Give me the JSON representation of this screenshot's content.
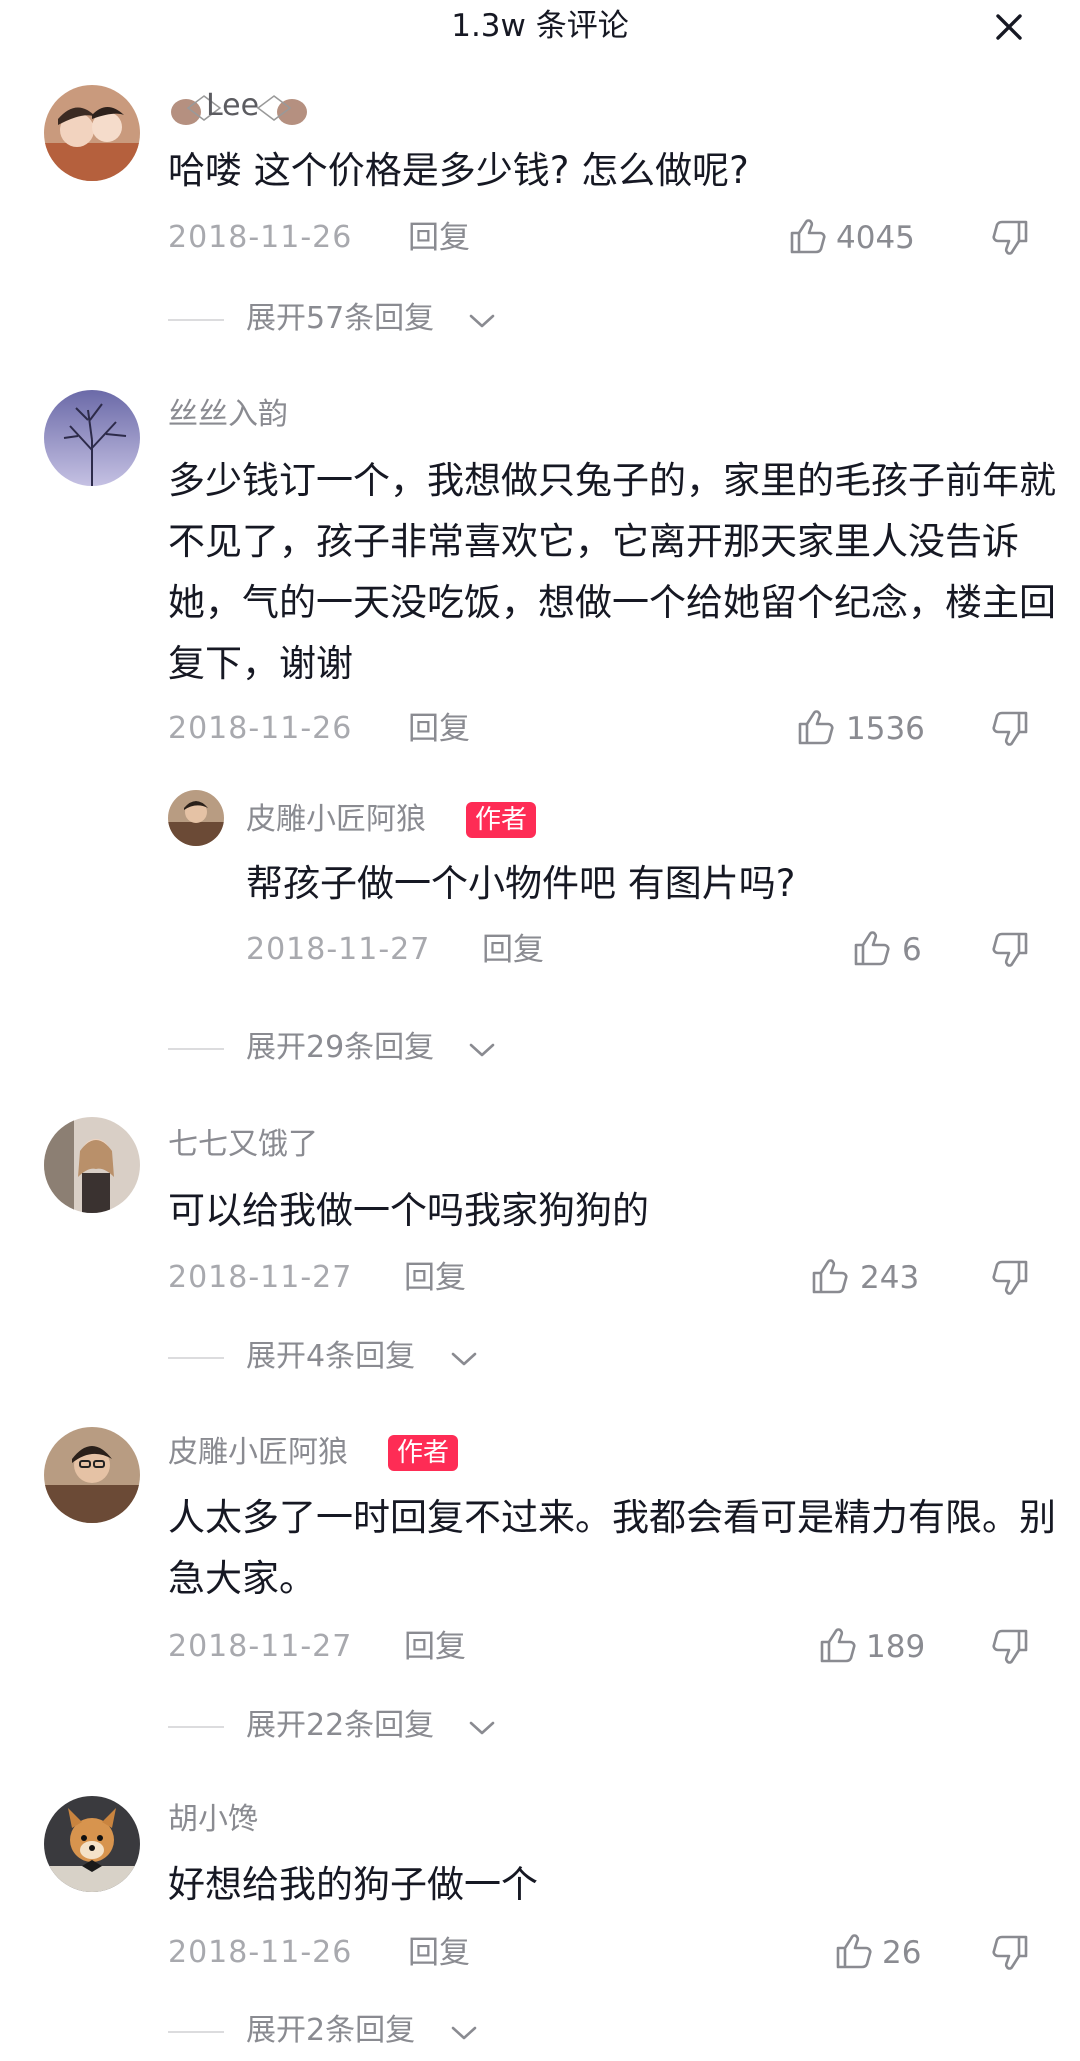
{
  "header": {
    "title": "1.3w 条评论"
  },
  "colors": {
    "accent": "#fe2c55",
    "text": "#161823",
    "meta": "#a8a9ae",
    "secondary": "#8a8b91"
  },
  "comments": [
    {
      "username": "Lee",
      "text": "哈喽 这个价格是多少钱? 怎么做呢?",
      "date": "2018-11-26",
      "reply_label": "回复",
      "likes": "4045",
      "expand_label": "展开57条回复"
    },
    {
      "username": "丝丝入韵",
      "text": "多少钱订一个，我想做只兔子的，家里的毛孩子前年就不见了，孩子非常喜欢它，它离开那天家里人没告诉她，气的一天没吃饭，想做一个给她留个纪念，楼主回复下，谢谢",
      "date": "2018-11-26",
      "reply_label": "回复",
      "likes": "1536",
      "sub_reply": {
        "username": "皮雕小匠阿狼",
        "badge": "作者",
        "text": "帮孩子做一个小物件吧 有图片吗?",
        "date": "2018-11-27",
        "reply_label": "回复",
        "likes": "6"
      },
      "expand_label": "展开29条回复"
    },
    {
      "username": "七七又饿了",
      "text": "可以给我做一个吗我家狗狗的",
      "date": "2018-11-27",
      "reply_label": "回复",
      "likes": "243",
      "expand_label": "展开4条回复"
    },
    {
      "username": "皮雕小匠阿狼",
      "badge": "作者",
      "text": "人太多了一时回复不过来。我都会看可是精力有限。别急大家。",
      "date": "2018-11-27",
      "reply_label": "回复",
      "likes": "189",
      "expand_label": "展开22条回复"
    },
    {
      "username": "胡小馋",
      "text": "好想给我的狗子做一个",
      "date": "2018-11-26",
      "reply_label": "回复",
      "likes": "26",
      "expand_label": "展开2条回复"
    }
  ]
}
